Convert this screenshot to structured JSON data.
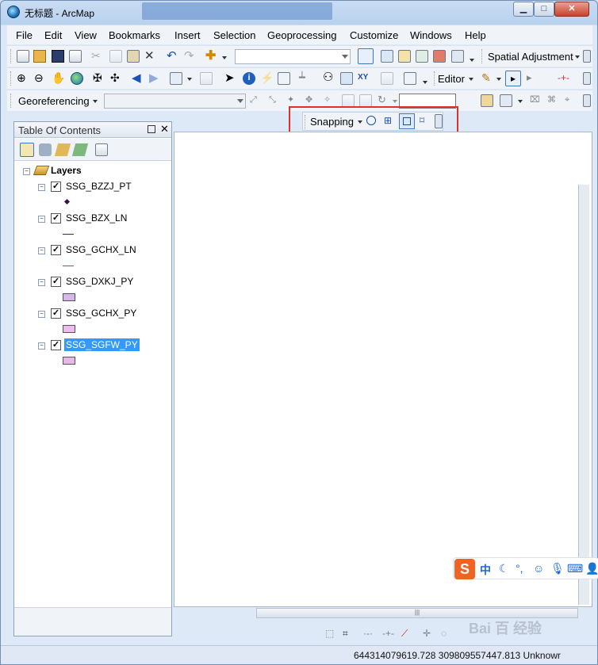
{
  "window": {
    "title": "无标题 - ArcMap",
    "min_label": "▭",
    "max_label": "□",
    "close_label": "✕"
  },
  "menu": [
    "File",
    "Edit",
    "View",
    "Bookmarks",
    "Insert",
    "Selection",
    "Geoprocessing",
    "Customize",
    "Windows",
    "Help"
  ],
  "toolbars": {
    "spatial_adjustment": "Spatial Adjustment",
    "editor": "Editor",
    "georeferencing": "Georeferencing",
    "snapping": "Snapping"
  },
  "toc": {
    "title": "Table Of Contents",
    "pin_icon": "pin-icon",
    "close_icon": "close-icon",
    "root": "Layers",
    "layers": [
      {
        "name": "SSG_BZZJ_PT",
        "checked": true,
        "symbol": "point",
        "color": "#3a1050",
        "selected": false
      },
      {
        "name": "SSG_BZX_LN",
        "checked": true,
        "symbol": "line",
        "color": "#1b2a8c",
        "selected": false
      },
      {
        "name": "SSG_GCHX_LN",
        "checked": true,
        "symbol": "line",
        "color": "#1f8a5a",
        "selected": false
      },
      {
        "name": "SSG_DXKJ_PY",
        "checked": true,
        "symbol": "polygon",
        "color": "#d5b8ea",
        "selected": false
      },
      {
        "name": "SSG_GCHX_PY",
        "checked": true,
        "symbol": "polygon",
        "color": "#ecbcec",
        "selected": false
      },
      {
        "name": "SSG_SGFW_PY",
        "checked": true,
        "symbol": "polygon",
        "color": "#e6b9e6",
        "selected": true
      }
    ]
  },
  "status": {
    "coordinates": "644314079619.728  309809557447.813 Unknowr"
  },
  "ime": {
    "logo": "S",
    "mode": "中",
    "punct": "°,"
  },
  "colors": {
    "highlight": "#e0302a",
    "selection": "#3399ff"
  }
}
